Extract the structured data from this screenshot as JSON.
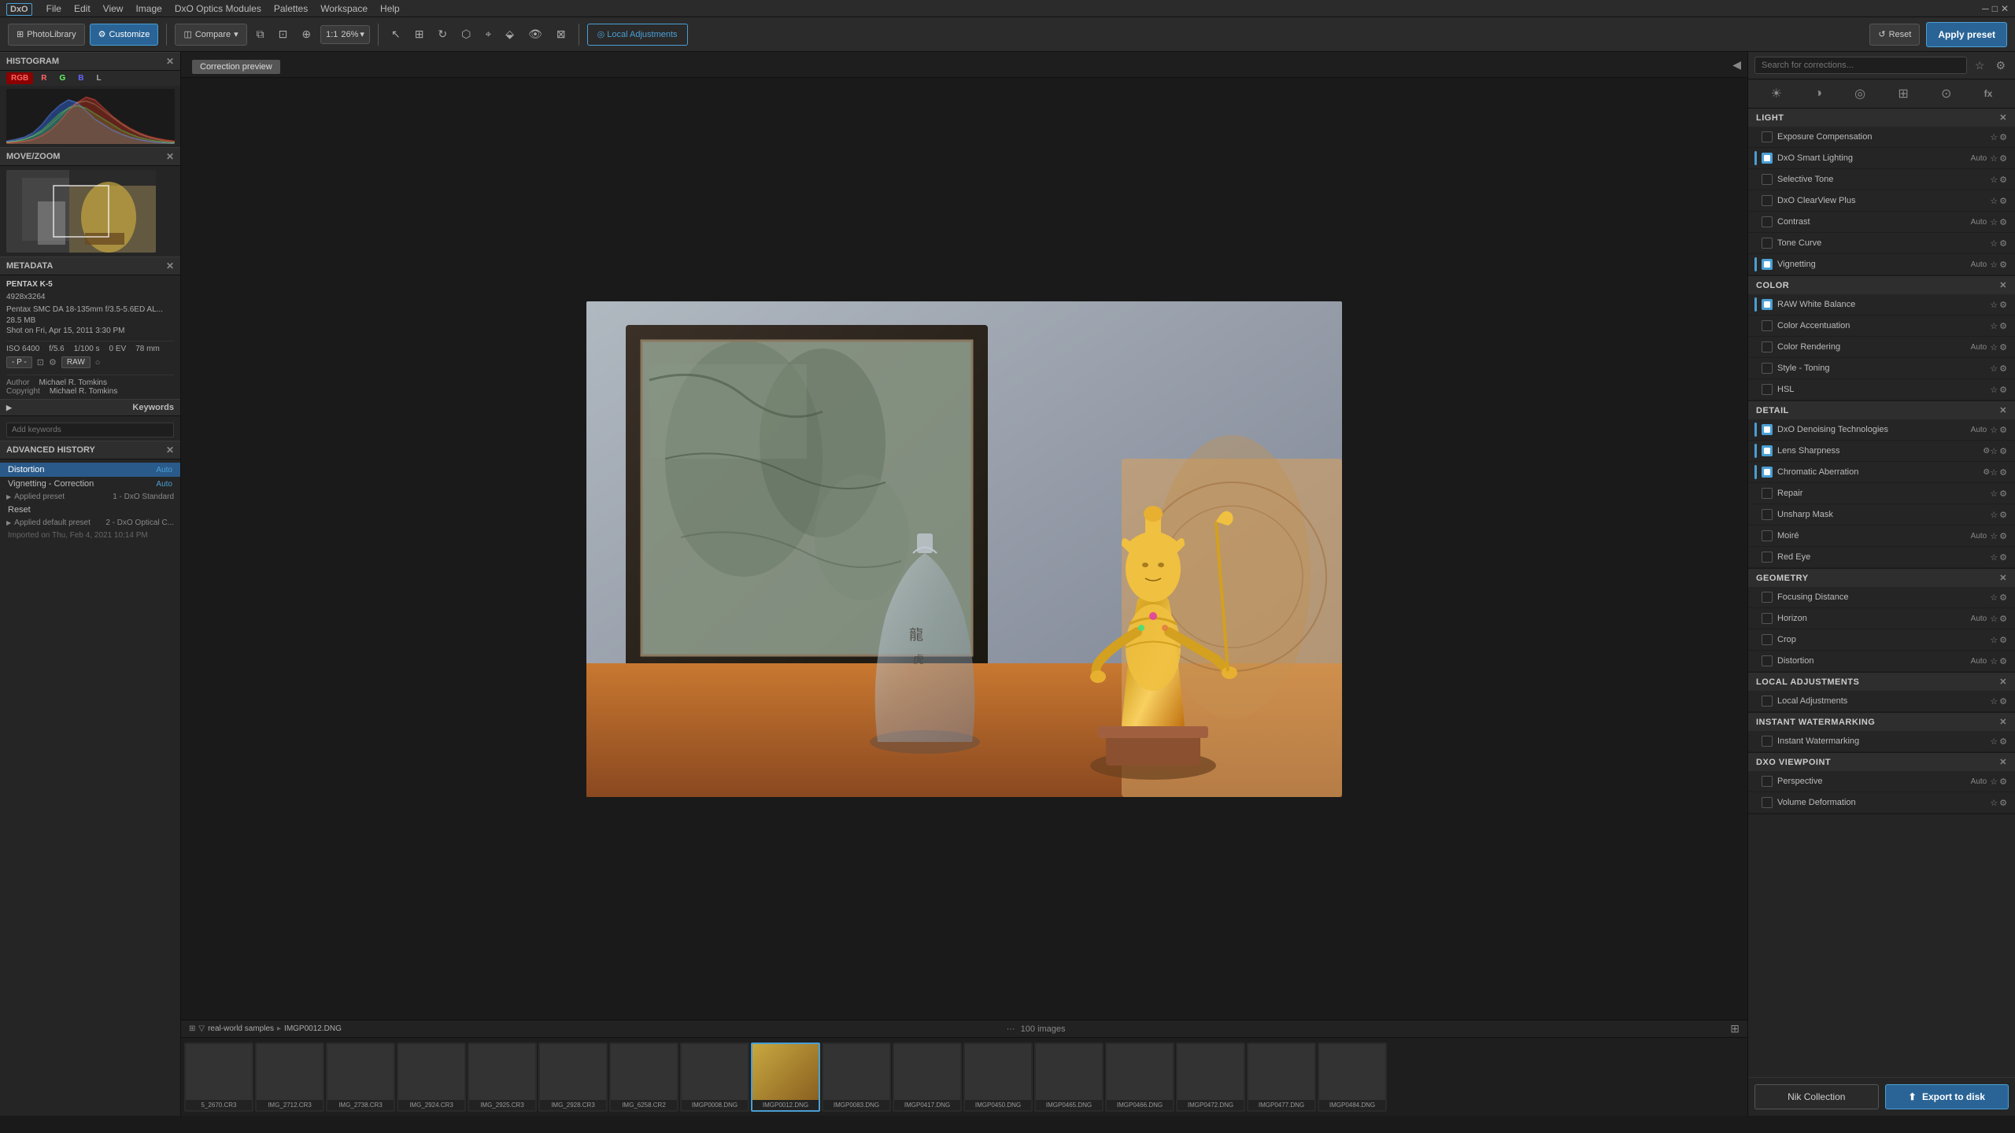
{
  "app": {
    "logo": "DxO",
    "title": "PhotoLibrary"
  },
  "menubar": {
    "items": [
      "File",
      "Edit",
      "View",
      "Image",
      "DxO Optics Modules",
      "Palettes",
      "Workspace",
      "Help"
    ]
  },
  "header": {
    "photo_library_label": "PhotoLibrary",
    "customize_label": "Customize",
    "compare_label": "Compare",
    "zoom_level": "26%",
    "local_adj_label": "Local Adjustments",
    "apply_preset_label": "Apply preset",
    "reset_label": "Reset"
  },
  "correction_preview": {
    "label": "Correction preview"
  },
  "left": {
    "histogram_label": "HISTOGRAM",
    "histogram_tabs": [
      "RGB",
      "R",
      "G",
      "B",
      "L"
    ],
    "movezoom_label": "MOVE/ZOOM",
    "metadata_label": "METADATA",
    "camera": "PENTAX K-5",
    "dimensions": "4928x3264",
    "lens": "Pentax SMC DA 18-135mm f/3.5-5.6ED AL...",
    "filesize": "28.5 MB",
    "shot_date": "Shot on Fri, Apr 15, 2011 3:30 PM",
    "iso": "ISO 6400",
    "aperture": "f/5.6",
    "shutter": "1/100 s",
    "ev": "0 EV",
    "focal": "78 mm",
    "rating": "- P -",
    "format": "RAW",
    "author_label": "Author",
    "author": "Michael R. Tomkins",
    "copyright_label": "Copyright",
    "copyright": "Michael R. Tomkins",
    "keywords_label": "Keywords",
    "keywords_placeholder": "Add keywords",
    "history_label": "ADVANCED HISTORY",
    "history_items": [
      {
        "name": "Distortion",
        "badge": "Auto",
        "active": true
      },
      {
        "name": "Vignetting - Correction",
        "badge": "Auto",
        "active": false
      },
      {
        "name": "Applied preset",
        "badge": "1 - DxO Standard",
        "active": false,
        "group": true
      },
      {
        "name": "Reset",
        "badge": "",
        "active": false
      },
      {
        "name": "Applied default preset",
        "badge": "2 - DxO Optical C...",
        "active": false,
        "group": true
      },
      {
        "name": "Imported on Thu, Feb 4, 2021 10:14 PM",
        "badge": "",
        "active": false,
        "dim": true
      }
    ]
  },
  "filmstrip": {
    "count_label": "100 images",
    "path": "real-world samples",
    "filename": "IMGP0012.DNG",
    "items": [
      {
        "name": "5_2670.CR3",
        "color": "t1"
      },
      {
        "name": "IMG_2712.CR3",
        "color": "t2"
      },
      {
        "name": "IMG_2738.CR3",
        "color": "t3"
      },
      {
        "name": "IMG_2924.CR3",
        "color": "t4"
      },
      {
        "name": "IMG_2925.CR3",
        "color": "t5"
      },
      {
        "name": "IMG_2928.CR3",
        "color": "t6"
      },
      {
        "name": "IMG_6258.CR2",
        "color": "t7"
      },
      {
        "name": "IMGP0008.DNG",
        "color": "t8"
      },
      {
        "name": "IMGP0012.DNG",
        "color": "t-active",
        "active": true
      },
      {
        "name": "IMGP0083.DNG",
        "color": "t9"
      },
      {
        "name": "IMGP0417.DNG",
        "color": "t1"
      },
      {
        "name": "IMGP0450.DNG",
        "color": "t2"
      },
      {
        "name": "IMGP0465.DNG",
        "color": "t3"
      },
      {
        "name": "IMGP0466.DNG",
        "color": "t4"
      },
      {
        "name": "IMGP0472.DNG",
        "color": "t5"
      },
      {
        "name": "IMGP0477.DNG",
        "color": "t6"
      },
      {
        "name": "IMGP0484.DNG",
        "color": "t7"
      }
    ]
  },
  "right": {
    "search_placeholder": "Search for corrections...",
    "sections": {
      "light": {
        "label": "LIGHT",
        "items": [
          {
            "name": "Exposure Compensation",
            "auto": "",
            "star": true,
            "active": false
          },
          {
            "name": "DxO Smart Lighting",
            "auto": "Auto",
            "star": true,
            "active": true
          },
          {
            "name": "Selective Tone",
            "auto": "",
            "star": true,
            "active": false
          },
          {
            "name": "DxO ClearView Plus",
            "auto": "",
            "star": true,
            "active": false
          },
          {
            "name": "Contrast",
            "auto": "Auto",
            "star": true,
            "active": false
          },
          {
            "name": "Tone Curve",
            "auto": "",
            "star": true,
            "active": false
          },
          {
            "name": "Vignetting",
            "auto": "Auto",
            "star": true,
            "active": true
          }
        ]
      },
      "color": {
        "label": "COLOR",
        "items": [
          {
            "name": "RAW White Balance",
            "auto": "",
            "star": true,
            "active": true
          },
          {
            "name": "Color Accentuation",
            "auto": "",
            "star": true,
            "active": false
          },
          {
            "name": "Color Rendering",
            "auto": "Auto",
            "star": true,
            "active": false
          },
          {
            "name": "Style - Toning",
            "auto": "",
            "star": true,
            "active": false
          },
          {
            "name": "HSL",
            "auto": "",
            "star": true,
            "active": false
          }
        ]
      },
      "detail": {
        "label": "DETAIL",
        "items": [
          {
            "name": "DxO Denoising Technologies",
            "auto": "Auto",
            "star": true,
            "active": true
          },
          {
            "name": "Lens Sharpness",
            "auto": "",
            "star": true,
            "active": true,
            "badge": "⚙"
          },
          {
            "name": "Chromatic Aberration",
            "auto": "",
            "star": true,
            "active": true,
            "badge": "⚙"
          },
          {
            "name": "Repair",
            "auto": "",
            "star": true,
            "active": false
          },
          {
            "name": "Unsharp Mask",
            "auto": "",
            "star": true,
            "active": false
          },
          {
            "name": "Moiré",
            "auto": "Auto",
            "star": true,
            "active": false
          },
          {
            "name": "Red Eye",
            "auto": "",
            "star": true,
            "active": false
          }
        ]
      },
      "geometry": {
        "label": "GEOMETRY",
        "items": [
          {
            "name": "Focusing Distance",
            "auto": "",
            "star": true,
            "active": false
          },
          {
            "name": "Horizon",
            "auto": "Auto",
            "star": true,
            "active": false
          },
          {
            "name": "Crop",
            "auto": "",
            "star": true,
            "active": false
          },
          {
            "name": "Distortion",
            "auto": "Auto",
            "star": true,
            "active": false
          }
        ]
      },
      "local_adjustments": {
        "label": "LOCAL ADJUSTMENTS",
        "items": [
          {
            "name": "Local Adjustments",
            "auto": "",
            "star": true,
            "active": false
          }
        ]
      },
      "instant_watermarking": {
        "label": "INSTANT WATERMARKING",
        "items": [
          {
            "name": "Instant Watermarking",
            "auto": "",
            "star": true,
            "active": false
          }
        ]
      },
      "dxo_viewpoint": {
        "label": "DXO VIEWPOINT",
        "items": [
          {
            "name": "Perspective",
            "auto": "Auto",
            "star": true,
            "active": false
          },
          {
            "name": "Volume Deformation",
            "auto": "",
            "star": true,
            "active": false
          }
        ]
      }
    },
    "nik_collection_label": "Nik Collection",
    "export_label": "Export to disk"
  }
}
